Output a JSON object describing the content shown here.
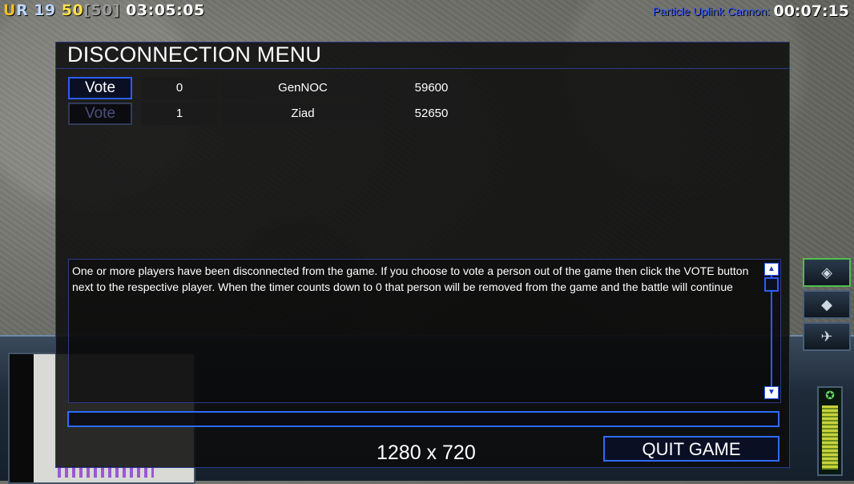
{
  "hud": {
    "faction_u": "U",
    "faction_r": "R",
    "units": "19",
    "power_current": "50",
    "power_cap": "[50]",
    "game_time": "03:05:05",
    "superweapon_label": "Particle Uplink Cannon:",
    "superweapon_timer": "00:07:15"
  },
  "dialog": {
    "title": "DISCONNECTION MENU",
    "players": [
      {
        "vote_label": "Vote",
        "index": "0",
        "name": "GenNOC",
        "score": "59600",
        "enabled": true
      },
      {
        "vote_label": "Vote",
        "index": "1",
        "name": "Ziad",
        "score": "52650",
        "enabled": false
      }
    ],
    "message": "One or more players have been disconnected from the game. If you choose to vote a person out of the game then click the VOTE button next to the respective player. When the timer counts down to 0 that person will be removed from the game and the battle will continue",
    "chat_value": "",
    "resolution": "1280 x 720",
    "quit_label": "QUIT GAME"
  },
  "colors": {
    "accent": "#2c5cff",
    "dialog_bg": "#0c0c0c",
    "superweapon_label": "#3a5cff",
    "power": "#ffe14a"
  },
  "icons": [
    "scroll-up-icon",
    "scroll-down-icon",
    "general-star-icon"
  ]
}
